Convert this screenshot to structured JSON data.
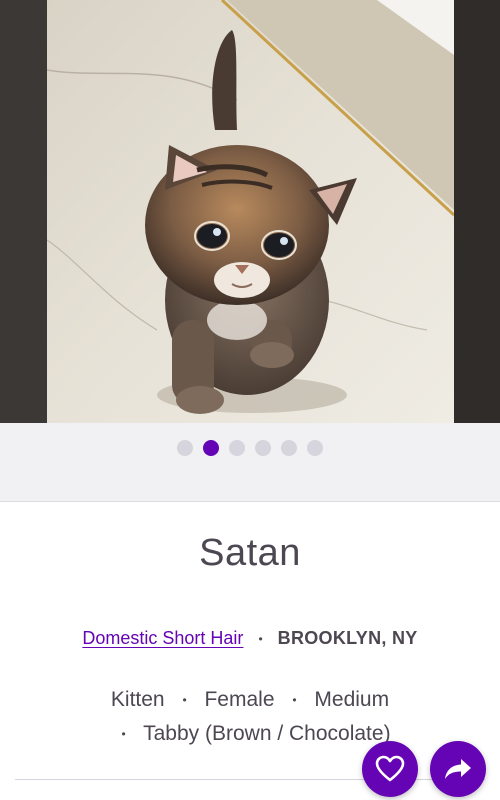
{
  "pet": {
    "name": "Satan",
    "breed": "Domestic Short Hair",
    "location": "BROOKLYN, NY",
    "age": "Kitten",
    "gender": "Female",
    "size": "Medium",
    "color": "Tabby (Brown / Chocolate)"
  },
  "carousel": {
    "total": 6,
    "active_index": 1
  },
  "separator": "•",
  "actions": {
    "favorite_icon": "heart-outline-icon",
    "share_icon": "share-arrow-icon"
  },
  "colors": {
    "accent": "#6504b5",
    "text": "#4d4751",
    "dot_inactive": "#d6d4dc",
    "carousel_bg": "#f1f0f3"
  }
}
